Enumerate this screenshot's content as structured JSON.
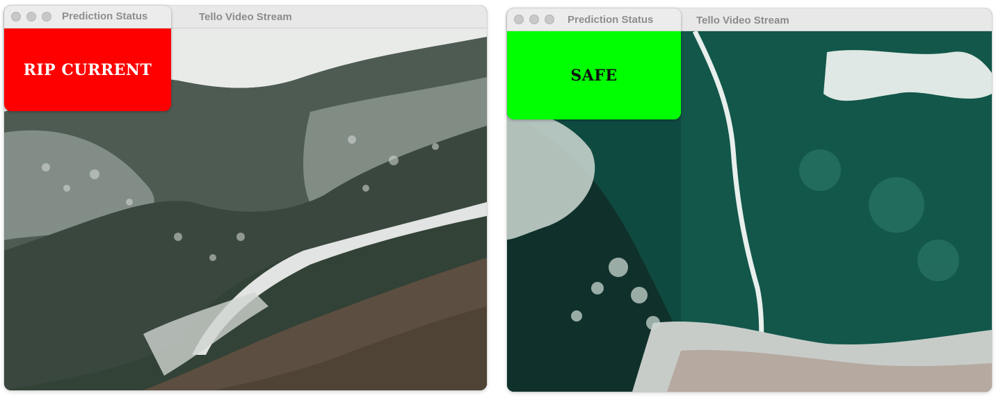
{
  "left": {
    "video_window_title": "Tello Video Stream",
    "status_window_title": "Prediction Status",
    "prediction": "RIP CURRENT",
    "prediction_bg": "#ff0000",
    "prediction_fg": "#ffffff"
  },
  "right": {
    "video_window_title": "Tello Video Stream",
    "status_window_title": "Prediction Status",
    "prediction": "SAFE",
    "prediction_bg": "#00ff00",
    "prediction_fg": "#111111"
  }
}
